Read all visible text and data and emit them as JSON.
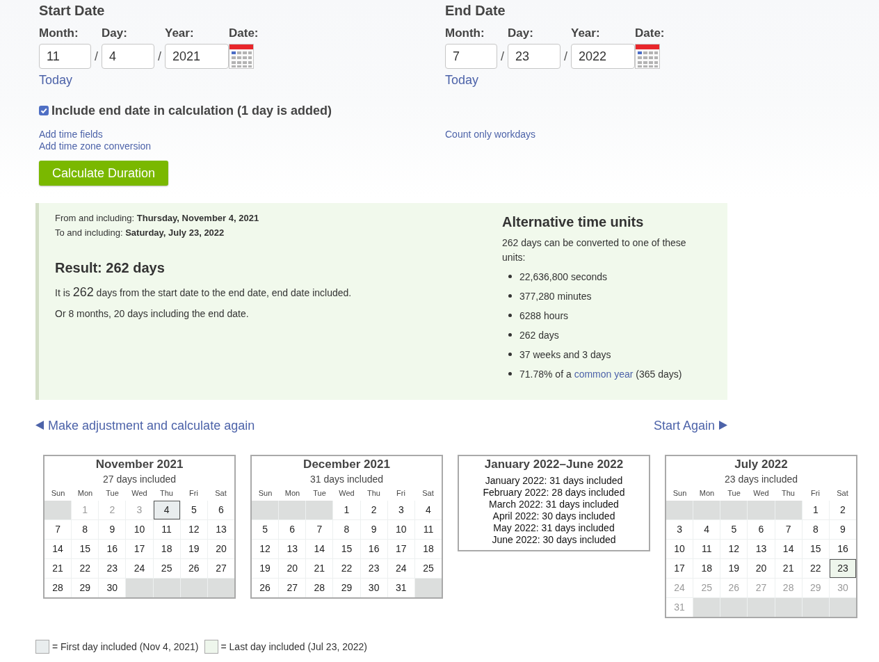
{
  "start": {
    "heading": "Start Date",
    "labels": [
      "Month:",
      "Day:",
      "Year:",
      "Date:"
    ],
    "month": "11",
    "day": "4",
    "year": "2021",
    "separators": [
      "/",
      "/"
    ],
    "today": "Today"
  },
  "end": {
    "heading": "End Date",
    "labels": [
      "Month:",
      "Day:",
      "Year:",
      "Date:"
    ],
    "month": "7",
    "day": "23",
    "year": "2022",
    "separators": [
      "/",
      "/"
    ],
    "today": "Today"
  },
  "include_end_date": {
    "label": "Include end date in calculation (1 day is added)",
    "checked": true
  },
  "options_left": [
    "Add time fields",
    "Add time zone conversion"
  ],
  "options_right": [
    "Count only workdays"
  ],
  "calculate_button": "Calculate Duration",
  "result": {
    "lines": [
      "From and including: **Thursday, November 4, 2021**",
      "To and including: **Saturday, July 23, 2022**"
    ],
    "heading": "Result: 262 days",
    "sentence": {
      "before": "It is",
      "number": "262",
      "after": "days from the start date to the end date, end date included."
    },
    "months_text": "Or 8 months, 20 days including the end date."
  },
  "alternative": {
    "heading": "Alternative time units",
    "intro": "262 days can be converted to one of these units:",
    "units": [
      {
        "kind": "plain",
        "text": "22,636,800 seconds"
      },
      {
        "kind": "plain",
        "text": "377,280 minutes"
      },
      {
        "kind": "plain",
        "text": "6288 hours"
      },
      {
        "kind": "plain",
        "text": "262 days"
      },
      {
        "kind": "plain",
        "text": "37 weeks and 3 days"
      },
      {
        "kind": "link",
        "before": "71.78% of a",
        "link": "common year",
        "after": "(365 days)"
      }
    ]
  },
  "nav": {
    "back": "Make adjustment and calculate again",
    "forward": "Start Again"
  },
  "calendars": [
    {
      "kind": "month",
      "title": "November 2021",
      "subtitle": "27 days included",
      "weekdays": [
        "Sun",
        "Mon",
        "Tue",
        "Wed",
        "Thu",
        "Fri",
        "Sat"
      ],
      "weeks": [
        [
          {
            "kind": "blank"
          },
          {
            "kind": "outside",
            "day": "1"
          },
          {
            "kind": "outside",
            "day": "2"
          },
          {
            "kind": "outside",
            "day": "3"
          },
          {
            "kind": "first",
            "day": "4"
          },
          {
            "kind": "inside",
            "day": "5"
          },
          {
            "kind": "inside",
            "day": "6"
          }
        ],
        [
          {
            "kind": "inside",
            "day": "7"
          },
          {
            "kind": "inside",
            "day": "8"
          },
          {
            "kind": "inside",
            "day": "9"
          },
          {
            "kind": "inside",
            "day": "10"
          },
          {
            "kind": "inside",
            "day": "11"
          },
          {
            "kind": "inside",
            "day": "12"
          },
          {
            "kind": "inside",
            "day": "13"
          }
        ],
        [
          {
            "kind": "inside",
            "day": "14"
          },
          {
            "kind": "inside",
            "day": "15"
          },
          {
            "kind": "inside",
            "day": "16"
          },
          {
            "kind": "inside",
            "day": "17"
          },
          {
            "kind": "inside",
            "day": "18"
          },
          {
            "kind": "inside",
            "day": "19"
          },
          {
            "kind": "inside",
            "day": "20"
          }
        ],
        [
          {
            "kind": "inside",
            "day": "21"
          },
          {
            "kind": "inside",
            "day": "22"
          },
          {
            "kind": "inside",
            "day": "23"
          },
          {
            "kind": "inside",
            "day": "24"
          },
          {
            "kind": "inside",
            "day": "25"
          },
          {
            "kind": "inside",
            "day": "26"
          },
          {
            "kind": "inside",
            "day": "27"
          }
        ],
        [
          {
            "kind": "inside",
            "day": "28"
          },
          {
            "kind": "inside",
            "day": "29"
          },
          {
            "kind": "inside",
            "day": "30"
          },
          {
            "kind": "blank"
          },
          {
            "kind": "blank"
          },
          {
            "kind": "blank"
          },
          {
            "kind": "blank"
          }
        ]
      ]
    },
    {
      "kind": "month",
      "title": "December 2021",
      "subtitle": "31 days included",
      "weekdays": [
        "Sun",
        "Mon",
        "Tue",
        "Wed",
        "Thu",
        "Fri",
        "Sat"
      ],
      "weeks": [
        [
          {
            "kind": "blank"
          },
          {
            "kind": "blank"
          },
          {
            "kind": "blank"
          },
          {
            "kind": "inside",
            "day": "1"
          },
          {
            "kind": "inside",
            "day": "2"
          },
          {
            "kind": "inside",
            "day": "3"
          },
          {
            "kind": "inside",
            "day": "4"
          }
        ],
        [
          {
            "kind": "inside",
            "day": "5"
          },
          {
            "kind": "inside",
            "day": "6"
          },
          {
            "kind": "inside",
            "day": "7"
          },
          {
            "kind": "inside",
            "day": "8"
          },
          {
            "kind": "inside",
            "day": "9"
          },
          {
            "kind": "inside",
            "day": "10"
          },
          {
            "kind": "inside",
            "day": "11"
          }
        ],
        [
          {
            "kind": "inside",
            "day": "12"
          },
          {
            "kind": "inside",
            "day": "13"
          },
          {
            "kind": "inside",
            "day": "14"
          },
          {
            "kind": "inside",
            "day": "15"
          },
          {
            "kind": "inside",
            "day": "16"
          },
          {
            "kind": "inside",
            "day": "17"
          },
          {
            "kind": "inside",
            "day": "18"
          }
        ],
        [
          {
            "kind": "inside",
            "day": "19"
          },
          {
            "kind": "inside",
            "day": "20"
          },
          {
            "kind": "inside",
            "day": "21"
          },
          {
            "kind": "inside",
            "day": "22"
          },
          {
            "kind": "inside",
            "day": "23"
          },
          {
            "kind": "inside",
            "day": "24"
          },
          {
            "kind": "inside",
            "day": "25"
          }
        ],
        [
          {
            "kind": "inside",
            "day": "26"
          },
          {
            "kind": "inside",
            "day": "27"
          },
          {
            "kind": "inside",
            "day": "28"
          },
          {
            "kind": "inside",
            "day": "29"
          },
          {
            "kind": "inside",
            "day": "30"
          },
          {
            "kind": "inside",
            "day": "31"
          },
          {
            "kind": "blank"
          }
        ]
      ]
    },
    {
      "kind": "summary",
      "title": "January 2022–June 2022",
      "lines": [
        "January 2022: 31 days included",
        "February 2022: 28 days included",
        "March 2022: 31 days included",
        "April 2022: 30 days included",
        "May 2022: 31 days included",
        "June 2022: 30 days included"
      ]
    },
    {
      "kind": "month",
      "title": "July 2022",
      "subtitle": "23 days included",
      "weekdays": [
        "Sun",
        "Mon",
        "Tue",
        "Wed",
        "Thu",
        "Fri",
        "Sat"
      ],
      "weeks": [
        [
          {
            "kind": "blank"
          },
          {
            "kind": "blank"
          },
          {
            "kind": "blank"
          },
          {
            "kind": "blank"
          },
          {
            "kind": "blank"
          },
          {
            "kind": "inside",
            "day": "1"
          },
          {
            "kind": "inside",
            "day": "2"
          }
        ],
        [
          {
            "kind": "inside",
            "day": "3"
          },
          {
            "kind": "inside",
            "day": "4"
          },
          {
            "kind": "inside",
            "day": "5"
          },
          {
            "kind": "inside",
            "day": "6"
          },
          {
            "kind": "inside",
            "day": "7"
          },
          {
            "kind": "inside",
            "day": "8"
          },
          {
            "kind": "inside",
            "day": "9"
          }
        ],
        [
          {
            "kind": "inside",
            "day": "10"
          },
          {
            "kind": "inside",
            "day": "11"
          },
          {
            "kind": "inside",
            "day": "12"
          },
          {
            "kind": "inside",
            "day": "13"
          },
          {
            "kind": "inside",
            "day": "14"
          },
          {
            "kind": "inside",
            "day": "15"
          },
          {
            "kind": "inside",
            "day": "16"
          }
        ],
        [
          {
            "kind": "inside",
            "day": "17"
          },
          {
            "kind": "inside",
            "day": "18"
          },
          {
            "kind": "inside",
            "day": "19"
          },
          {
            "kind": "inside",
            "day": "20"
          },
          {
            "kind": "inside",
            "day": "21"
          },
          {
            "kind": "inside",
            "day": "22"
          },
          {
            "kind": "last",
            "day": "23"
          }
        ],
        [
          {
            "kind": "outside",
            "day": "24"
          },
          {
            "kind": "outside",
            "day": "25"
          },
          {
            "kind": "outside",
            "day": "26"
          },
          {
            "kind": "outside",
            "day": "27"
          },
          {
            "kind": "outside",
            "day": "28"
          },
          {
            "kind": "outside",
            "day": "29"
          },
          {
            "kind": "outside",
            "day": "30"
          }
        ],
        [
          {
            "kind": "outside",
            "day": "31"
          },
          {
            "kind": "blank"
          },
          {
            "kind": "blank"
          },
          {
            "kind": "blank"
          },
          {
            "kind": "blank"
          },
          {
            "kind": "blank"
          },
          {
            "kind": "blank"
          }
        ]
      ]
    }
  ],
  "legend": [
    {
      "kind": "first",
      "text": "= First day included (Nov 4, 2021)"
    },
    {
      "kind": "last",
      "text": "= Last day included (Jul 23, 2022)"
    }
  ]
}
